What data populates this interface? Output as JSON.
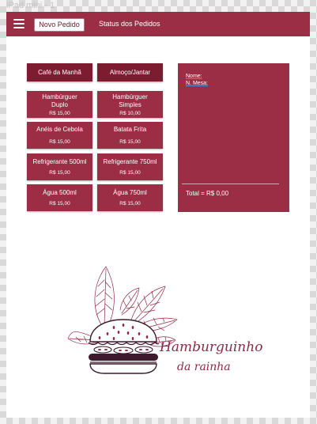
{
  "device_label": "iPad mini - 1",
  "navbar": {
    "new_order_label": "Novo Pedido",
    "status_label": "Status dos Pedidos"
  },
  "categories": [
    {
      "label": "Café da Manhã"
    },
    {
      "label": "Almoço/Jantar"
    }
  ],
  "menu_items": [
    {
      "name": "Hambúrguer Duplo",
      "price": "R$ 15,00"
    },
    {
      "name": "Hambúrguer Simples",
      "price": "R$ 10,00"
    },
    {
      "name": "Anéis de Cebola",
      "price": "R$ 15,00"
    },
    {
      "name": "Batata Frita",
      "price": "R$ 15,00"
    },
    {
      "name": "Refrigerante 500ml",
      "price": "R$ 15,00"
    },
    {
      "name": "Refrigerante 750ml",
      "price": "R$ 15,00"
    },
    {
      "name": "Água 500ml",
      "price": "R$ 15,00"
    },
    {
      "name": "Água 750ml",
      "price": "R$ 15,00"
    }
  ],
  "order": {
    "name_label": "Nome:",
    "table_label": "N. Mesa:",
    "total_label": "Total = R$ 0,00"
  },
  "brand": {
    "line1": "Hamburguinho",
    "line2": "da rainha"
  },
  "colors": {
    "primary": "#9b2d45",
    "category": "#7d1b31",
    "logo_text": "#8e2a45"
  }
}
